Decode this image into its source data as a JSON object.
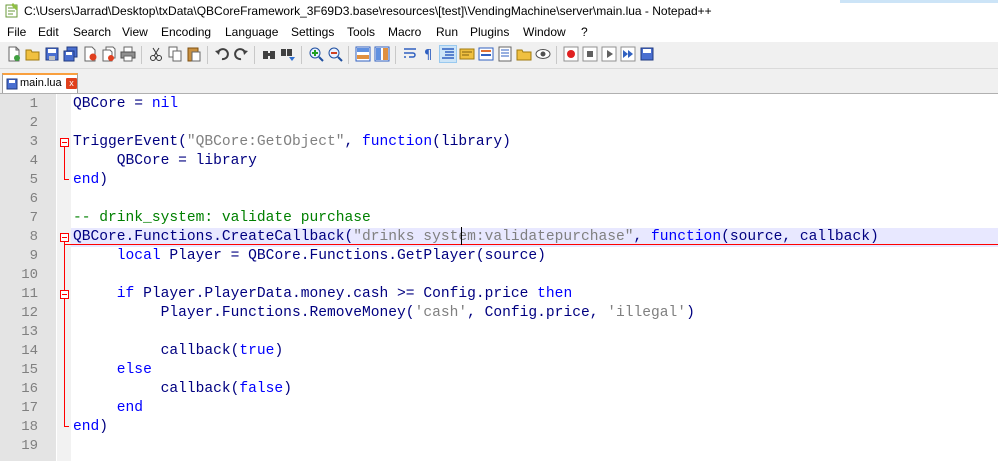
{
  "window": {
    "title": "C:\\Users\\Jarrad\\Desktop\\txData\\QBCoreFramework_3F69D3.base\\resources\\[test]\\VendingMachine\\server\\main.lua - Notepad++"
  },
  "menu": [
    "File",
    "Edit",
    "Search",
    "View",
    "Encoding",
    "Language",
    "Settings",
    "Tools",
    "Macro",
    "Run",
    "Plugins",
    "Window",
    "?"
  ],
  "tab": {
    "label": "main.lua",
    "close": "x"
  },
  "line_numbers": [
    "1",
    "2",
    "3",
    "4",
    "5",
    "6",
    "7",
    "8",
    "9",
    "10",
    "11",
    "12",
    "13",
    "14",
    "15",
    "16",
    "17",
    "18",
    "19"
  ],
  "code_lines": [
    [
      {
        "t": "QBCore",
        "c": "op"
      },
      {
        "t": " = ",
        "c": "op"
      },
      {
        "t": "nil",
        "c": "kw"
      }
    ],
    [],
    [
      {
        "t": "TriggerEvent(",
        "c": "op"
      },
      {
        "t": "\"QBCore:GetObject\"",
        "c": "str"
      },
      {
        "t": ", ",
        "c": "op"
      },
      {
        "t": "function",
        "c": "kw"
      },
      {
        "t": "(library)",
        "c": "op"
      }
    ],
    [
      {
        "t": "     QBCore = library",
        "c": "op"
      }
    ],
    [
      {
        "t": "end",
        "c": "kw"
      },
      {
        "t": ")",
        "c": "op"
      }
    ],
    [],
    [
      {
        "t": "-- drink_system: validate purchase",
        "c": "cmt"
      }
    ],
    [
      {
        "t": "QBCore.Functions.CreateCallback(",
        "c": "op"
      },
      {
        "t": "\"drinks system:validatepurchase\"",
        "c": "str"
      },
      {
        "t": ", ",
        "c": "op"
      },
      {
        "t": "function",
        "c": "kw"
      },
      {
        "t": "(source, callback)",
        "c": "op"
      }
    ],
    [
      {
        "t": "     ",
        "c": "op"
      },
      {
        "t": "local",
        "c": "kw"
      },
      {
        "t": " Player = QBCore.Functions.GetPlayer(source)",
        "c": "op"
      }
    ],
    [],
    [
      {
        "t": "     ",
        "c": "op"
      },
      {
        "t": "if",
        "c": "kw"
      },
      {
        "t": " Player.PlayerData.money.cash >= Config.price ",
        "c": "op"
      },
      {
        "t": "then",
        "c": "kw"
      }
    ],
    [
      {
        "t": "          Player.Functions.RemoveMoney(",
        "c": "op"
      },
      {
        "t": "'cash'",
        "c": "str"
      },
      {
        "t": ", Config.price, ",
        "c": "op"
      },
      {
        "t": "'illegal'",
        "c": "str"
      },
      {
        "t": ")",
        "c": "op"
      }
    ],
    [],
    [
      {
        "t": "          callback(",
        "c": "op"
      },
      {
        "t": "true",
        "c": "kw"
      },
      {
        "t": ")",
        "c": "op"
      }
    ],
    [
      {
        "t": "     ",
        "c": "op"
      },
      {
        "t": "else",
        "c": "kw"
      }
    ],
    [
      {
        "t": "          callback(",
        "c": "op"
      },
      {
        "t": "false",
        "c": "kw"
      },
      {
        "t": ")",
        "c": "op"
      }
    ],
    [
      {
        "t": "     ",
        "c": "op"
      },
      {
        "t": "end",
        "c": "kw"
      }
    ],
    [
      {
        "t": "end",
        "c": "kw"
      },
      {
        "t": ")",
        "c": "op"
      }
    ],
    []
  ],
  "colors": {
    "keyword": "#0000ff",
    "string": "#808080",
    "comment": "#008000",
    "default": "#000080",
    "fold": "#ff0000",
    "current_line": "#e8e8ff"
  },
  "icons": [
    "new-file-icon",
    "open-file-icon",
    "save-icon",
    "save-all-icon",
    "close-icon",
    "close-all-icon",
    "print-icon",
    "cut-icon",
    "copy-icon",
    "paste-icon",
    "undo-icon",
    "redo-icon",
    "find-icon",
    "replace-icon",
    "zoom-in-icon",
    "zoom-out-icon",
    "sync-vertical-icon",
    "sync-horizontal-icon",
    "word-wrap-icon",
    "show-all-chars-icon",
    "indent-guide-icon",
    "language-icon",
    "doc-map-icon",
    "function-list-icon",
    "folder-workspace-icon",
    "monitor-icon",
    "record-macro-icon",
    "stop-record-icon",
    "play-macro-icon",
    "run-macro-multiple-icon",
    "save-macro-icon"
  ]
}
